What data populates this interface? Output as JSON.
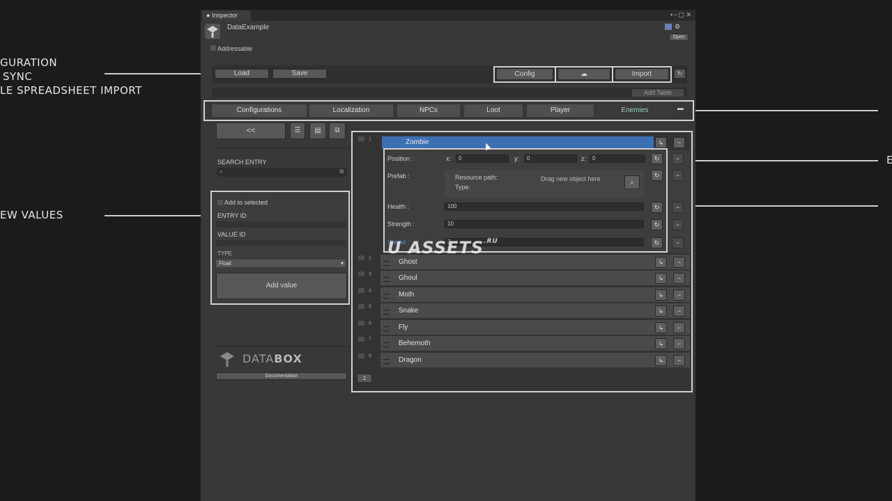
{
  "annotations": {
    "line1": "GURATION",
    "line2": "SYNC",
    "line3": "LE SPREADSHEET IMPORT",
    "new_values": "EW VALUES",
    "right_letter": "E"
  },
  "inspector": {
    "tab_label": "Inspector",
    "asset_name": "DataExample",
    "addressable_label": "Addressable",
    "open_label": "Open"
  },
  "toolbar": {
    "load": "Load",
    "save": "Save",
    "config": "Config",
    "cloud_icon": "cloud-icon",
    "import": "Import",
    "add_table": "Add Table"
  },
  "tables": [
    "Configurations",
    "Localization",
    "NPCs",
    "Loot",
    "Player",
    "Enemies"
  ],
  "left_panel": {
    "back": "<<",
    "search_label": "SEARCH ENTRY",
    "add_to_selected": "Add to selected",
    "entry_id": "ENTRY ID",
    "value_id": "VALUE ID",
    "type_label": "TYPE",
    "type_value": "Float",
    "add_value": "Add value",
    "logo_text_a": "DATA",
    "logo_text_b": "BOX",
    "documentation": "Documentation"
  },
  "selected_entry": {
    "name": "Zombie",
    "index": "1",
    "position": {
      "label": "Position :",
      "x_label": "x:",
      "x": "0",
      "y_label": "y:",
      "y": "0",
      "z_label": "z:",
      "z": "0"
    },
    "prefab": {
      "label": "Prefab :",
      "resource_path": "Resource path:",
      "type": "Type:",
      "drop_hint": "Drag new object here"
    },
    "health": {
      "label": "Health :",
      "value": "100"
    },
    "strength": {
      "label": "Strength :",
      "value": "10"
    },
    "speed": {
      "label": "Speed :",
      "value": "2"
    }
  },
  "entries": [
    {
      "index": "2",
      "name": "Ghost"
    },
    {
      "index": "3",
      "name": "Ghoul"
    },
    {
      "index": "4",
      "name": "Moth"
    },
    {
      "index": "5",
      "name": "Snake"
    },
    {
      "index": "6",
      "name": "Fly"
    },
    {
      "index": "7",
      "name": "Behemoth"
    },
    {
      "index": "8",
      "name": "Dragon"
    }
  ],
  "pagination": {
    "page": "1"
  },
  "watermark": {
    "text": "U ASSETS",
    "suffix": ".RU"
  },
  "colors": {
    "selected_row": "#3d6fb3",
    "panel_bg": "#383838",
    "outline": "#d2d2d2"
  }
}
